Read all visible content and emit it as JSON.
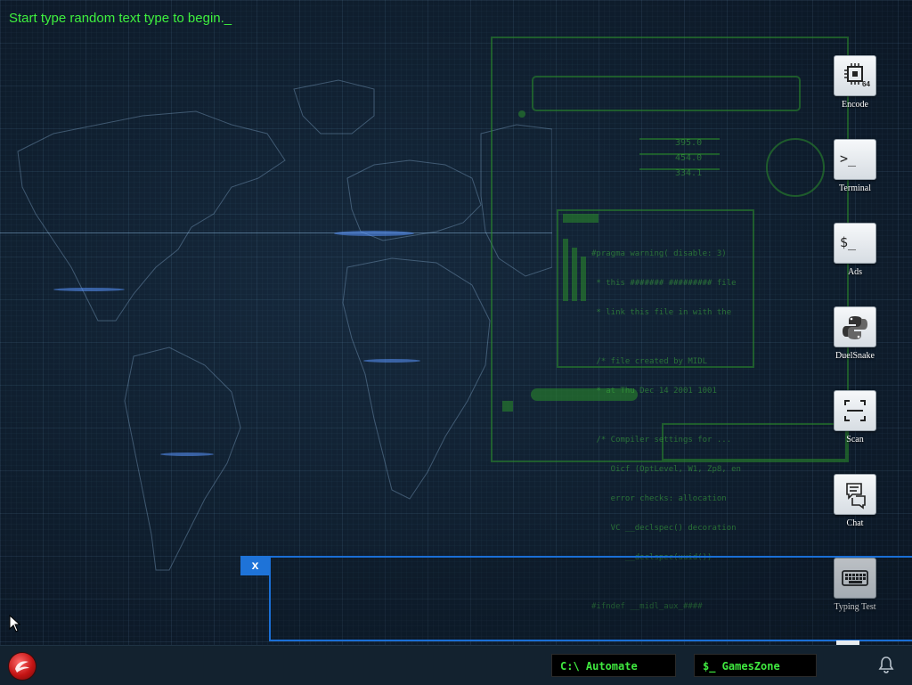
{
  "prompt": {
    "text": "Start type random text type to begin._"
  },
  "desktop_icons": [
    {
      "label": "Encode",
      "icon": "chip-64-icon"
    },
    {
      "label": "Terminal",
      "icon": "terminal-icon"
    },
    {
      "label": "Ads",
      "icon": "dollar-prompt-icon"
    },
    {
      "label": "DuelSnake",
      "icon": "python-icon"
    },
    {
      "label": "Scan",
      "icon": "scan-icon"
    },
    {
      "label": "Chat",
      "icon": "chat-icon"
    },
    {
      "label": "Typing Test",
      "icon": "keyboard-icon"
    }
  ],
  "tiles": {
    "chip_text": "64",
    "terminal_text": ">_",
    "ads_text": "$_"
  },
  "popup": {
    "close_label": "x"
  },
  "console_nums": [
    "395.0",
    "454.0",
    "334.1"
  ],
  "console_lines": [
    "#pragma warning( disable: 3)",
    " * this ####### ######### file",
    " * link this file in with the",
    "",
    " /* file created by MIDL",
    " * at Thu Dec 14 2001 1001",
    "",
    " /* Compiler settings for ...",
    "    Oicf (OptLevel, W1, Zp8, en",
    "    error checks: allocation",
    "    VC __declspec() decoration",
    "       __declspec(uuid())",
    "",
    "#ifndef __midl_aux_####"
  ],
  "taskbar": {
    "automate_label": "C:\\ Automate",
    "gameszone_label": "$_ GamesZone"
  },
  "colors": {
    "accent_green": "#3ef03e",
    "popup_blue": "#1a6fd6",
    "start_red": "#c41414"
  }
}
